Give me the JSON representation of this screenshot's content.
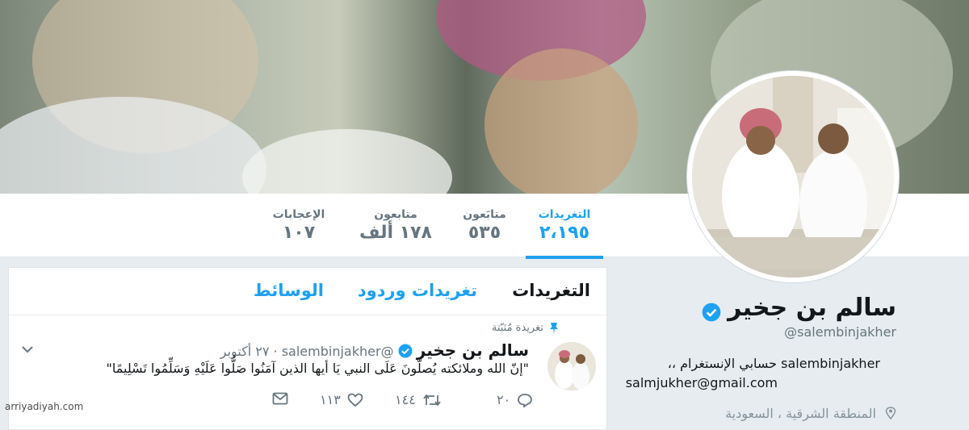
{
  "stats": [
    {
      "label": "التغريدات",
      "value": "٢،١٩٥",
      "active": true
    },
    {
      "label": "متابَعون",
      "value": "٥٣٥",
      "active": false
    },
    {
      "label": "متابعون",
      "value": "١٧٨ ألف",
      "active": false
    },
    {
      "label": "الإعجابات",
      "value": "١٠٧",
      "active": false
    }
  ],
  "tabs": [
    "التغريدات",
    "تغريدات وردود",
    "الوسائط"
  ],
  "profile": {
    "name": "سالم بن جخير",
    "handle": "@salembinjakher",
    "bio_line1": "salembinjakher حسابي الإنستغرام ،،",
    "bio_line2": "salmjukher@gmail.com",
    "location": "المنطقة الشرقية ، السعودية"
  },
  "pinned_tweet": {
    "pinned_label": "تغريدة مُثبّتة",
    "name": "سالم بن جخير",
    "handle": "@salembinjakher",
    "date": "٢٧ أكتوبر",
    "text": "\"إنّ الله وملائكته يُصلّونَ عَلَى النبي يَا أيها الذين آمَنُوا صَلُّوا عَلَيْهِ وَسَلِّمُوا تَسْلِيمًا\"",
    "replies": "٢٠",
    "retweets": "١٤٤",
    "likes": "١١٣"
  },
  "watermark": "arriyadiyah.com",
  "colors": {
    "accent": "#1da1f2",
    "text": "#14171a",
    "muted": "#66757f",
    "background": "#e6ecf0"
  },
  "icons": [
    "pin-icon",
    "verified-badge-icon",
    "chevron-down-icon",
    "reply-icon",
    "retweet-icon",
    "like-icon",
    "message-icon",
    "location-icon"
  ]
}
